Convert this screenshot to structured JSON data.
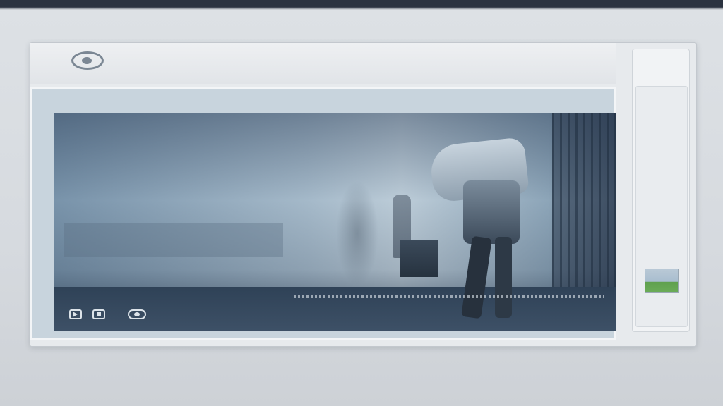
{
  "app": {
    "brand_name": "",
    "brand_sub": ""
  },
  "hero": {
    "episode_badge": "",
    "title": "",
    "subtitle_line1": "",
    "subtitle_line2": "",
    "meta": "",
    "description": [
      "",
      ""
    ],
    "caption": "",
    "caption_secondary": ""
  },
  "controls": {
    "play_icon": "play-icon",
    "next_icon": "next-icon",
    "settings_icon": "settings-icon"
  },
  "side_panel": {
    "header": "",
    "items": [
      "",
      "",
      "",
      "",
      "",
      "",
      "",
      ""
    ],
    "footer": ""
  },
  "colors": {
    "top_bar": "#2b3340",
    "background": "#d6dadf",
    "accent_text": "#e8eef3"
  }
}
